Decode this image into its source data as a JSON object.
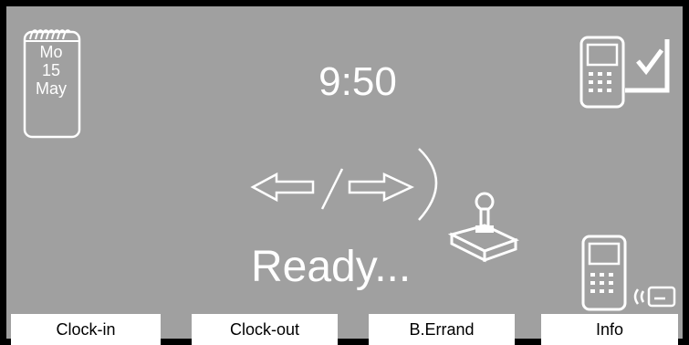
{
  "clock": {
    "time": "9:50"
  },
  "calendar": {
    "weekday": "Mo",
    "day": "15",
    "month": "May"
  },
  "status": {
    "text": "Ready..."
  },
  "buttons": [
    {
      "label": "Clock-in"
    },
    {
      "label": "Clock-out"
    },
    {
      "label": "B.Errand"
    },
    {
      "label": "Info"
    }
  ],
  "icons": {
    "calendar": "calendar-icon",
    "terminal_check": "terminal-check-icon",
    "transfer": "bidirectional-arrows-icon",
    "joystick": "joystick-icon",
    "terminal_card": "terminal-card-reader-icon"
  },
  "colors": {
    "screen_bg": "#a0a0a0",
    "foreground": "#ffffff",
    "frame": "#000000"
  }
}
